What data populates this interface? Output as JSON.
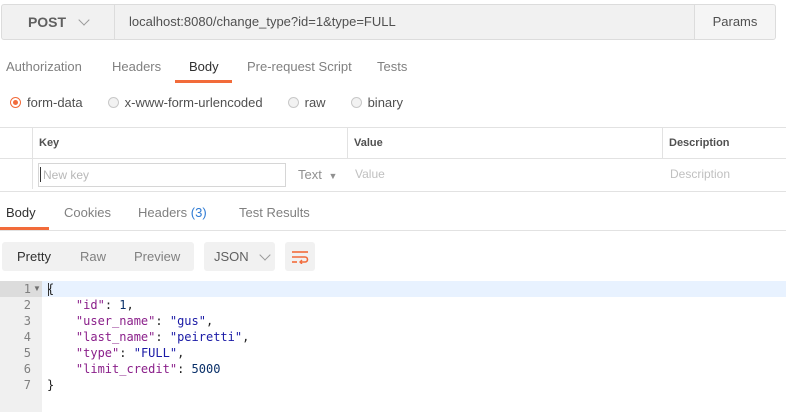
{
  "request": {
    "method": "POST",
    "url": "localhost:8080/change_type?id=1&type=FULL",
    "params_label": "Params"
  },
  "request_tabs": [
    {
      "label": "Authorization",
      "active": false
    },
    {
      "label": "Headers",
      "active": false
    },
    {
      "label": "Body",
      "active": true
    },
    {
      "label": "Pre-request Script",
      "active": false
    },
    {
      "label": "Tests",
      "active": false
    }
  ],
  "body_types": [
    {
      "label": "form-data",
      "selected": true
    },
    {
      "label": "x-www-form-urlencoded",
      "selected": false
    },
    {
      "label": "raw",
      "selected": false
    },
    {
      "label": "binary",
      "selected": false
    }
  ],
  "kv_table": {
    "headers": {
      "key": "Key",
      "value": "Value",
      "description": "Description"
    },
    "key_placeholder": "New key",
    "type_label": "Text",
    "value_placeholder": "Value",
    "description_placeholder": "Description"
  },
  "response_tabs": {
    "body": "Body",
    "cookies": "Cookies",
    "headers": "Headers",
    "headers_count": "(3)",
    "test_results": "Test Results"
  },
  "view": {
    "pretty": "Pretty",
    "raw": "Raw",
    "preview": "Preview",
    "format": "JSON"
  },
  "code": {
    "line_numbers": [
      "1",
      "2",
      "3",
      "4",
      "5",
      "6",
      "7"
    ],
    "open_brace": "{",
    "close_brace": "}",
    "fields": [
      {
        "key": "\"id\"",
        "value": "1",
        "kind": "number"
      },
      {
        "key": "\"user_name\"",
        "value": "\"gus\"",
        "kind": "string"
      },
      {
        "key": "\"last_name\"",
        "value": "\"peiretti\"",
        "kind": "string"
      },
      {
        "key": "\"type\"",
        "value": "\"FULL\"",
        "kind": "string"
      },
      {
        "key": "\"limit_credit\"",
        "value": "5000",
        "kind": "number"
      }
    ]
  },
  "colors": {
    "accent": "#f26b3a",
    "link_blue": "#2f7bd4"
  }
}
